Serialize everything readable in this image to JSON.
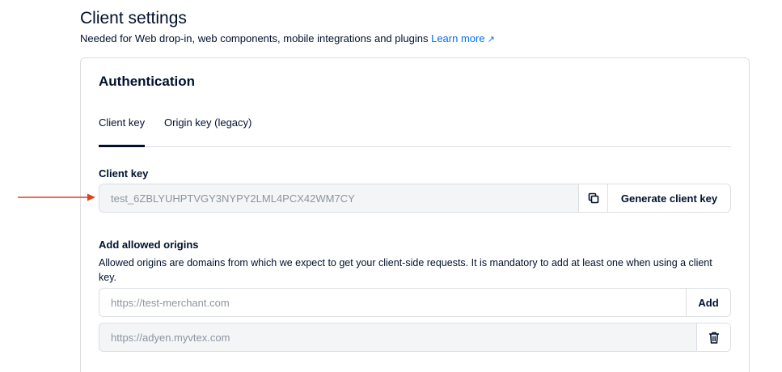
{
  "header": {
    "title": "Client settings",
    "subtitle": "Needed for Web drop-in, web components, mobile integrations and plugins",
    "learn_more": "Learn more",
    "learn_more_icon": "external-link-arrow"
  },
  "auth": {
    "title": "Authentication",
    "tabs": [
      {
        "label": "Client key",
        "active": true
      },
      {
        "label": "Origin key (legacy)",
        "active": false
      }
    ],
    "client_key": {
      "label": "Client key",
      "value": "test_6ZBLYUHPTVGY3NYPY2LML4PCX42WM7CY",
      "copy_icon": "copy-icon",
      "generate_label": "Generate client key"
    },
    "origins": {
      "label": "Add allowed origins",
      "description": "Allowed origins are domains from which we expect to get your client-side requests. It is mandatory to add at least one when using a client key.",
      "input_placeholder": "https://test-merchant.com",
      "add_label": "Add",
      "entries": [
        {
          "value": "https://adyen.myvtex.com",
          "delete_icon": "trash-icon"
        }
      ]
    }
  },
  "colors": {
    "text": "#00112c",
    "link": "#0070f5",
    "border": "#dbdee2",
    "input_bg": "#f3f5f6",
    "annotation": "#d9431e"
  }
}
